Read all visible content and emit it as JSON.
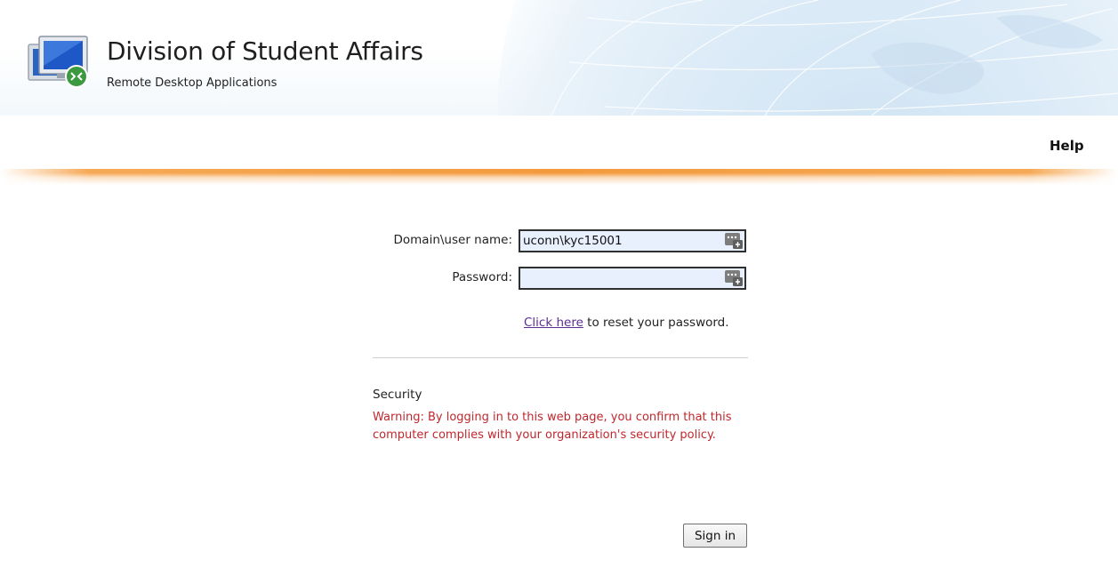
{
  "header": {
    "title": "Division of Student Affairs",
    "subtitle": "Remote Desktop Applications",
    "logo_icon": "remote-desktop-monitor-icon"
  },
  "nav": {
    "help_label": "Help"
  },
  "login_form": {
    "username_label": "Domain\\user name:",
    "username_value": "uconn\\kyc15001",
    "password_label": "Password:",
    "password_value": "",
    "field_icon": "password-manager-key-icon",
    "reset_link_text": "Click here",
    "reset_suffix": " to reset your password."
  },
  "security": {
    "title": "Security",
    "warning": "Warning: By logging in to this web page, you confirm that this computer complies with your organization's security policy."
  },
  "actions": {
    "sign_in_label": "Sign in"
  },
  "colors": {
    "accent_orange": "#f39a3c",
    "warning_red": "#c0272d",
    "link_purple": "#5b2f8f",
    "autofill_blue": "#e8f0fe"
  }
}
